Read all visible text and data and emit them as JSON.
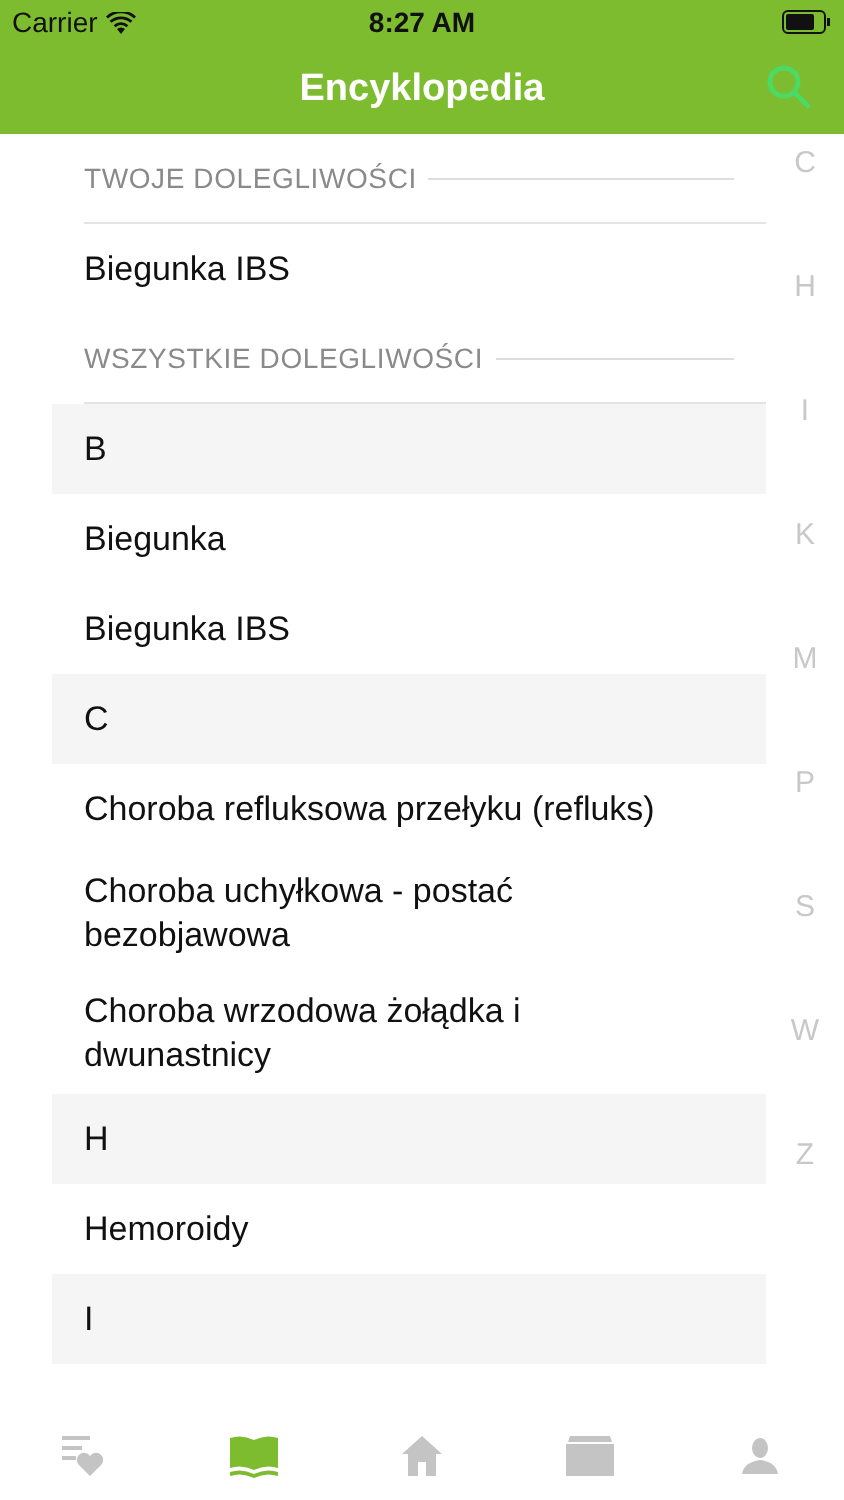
{
  "status_bar": {
    "carrier": "Carrier",
    "time": "8:27 AM"
  },
  "nav": {
    "title": "Encyklopedia"
  },
  "sections": [
    {
      "title": "TWOJE DOLEGLIWOŚCI",
      "groups": [
        {
          "items": [
            "Biegunka IBS"
          ]
        }
      ]
    },
    {
      "title": "WSZYSTKIE DOLEGLIWOŚCI",
      "groups": [
        {
          "letter": "B",
          "items": [
            "Biegunka",
            "Biegunka IBS"
          ]
        },
        {
          "letter": "C",
          "items": [
            "Choroba refluksowa przełyku (refluks)",
            "Choroba uchyłkowa - postać bezobjawowa",
            "Choroba wrzodowa żołądka i dwunastnicy"
          ]
        },
        {
          "letter": "H",
          "items": [
            "Hemoroidy"
          ]
        },
        {
          "letter": "I"
        }
      ]
    }
  ],
  "index": [
    "C",
    "H",
    "I",
    "K",
    "M",
    "P",
    "S",
    "W",
    "Z"
  ],
  "tabs": [
    {
      "kind": "feed",
      "selected": false
    },
    {
      "kind": "book",
      "selected": true
    },
    {
      "kind": "home",
      "selected": false
    },
    {
      "kind": "box",
      "selected": false
    },
    {
      "kind": "person",
      "selected": false
    }
  ]
}
